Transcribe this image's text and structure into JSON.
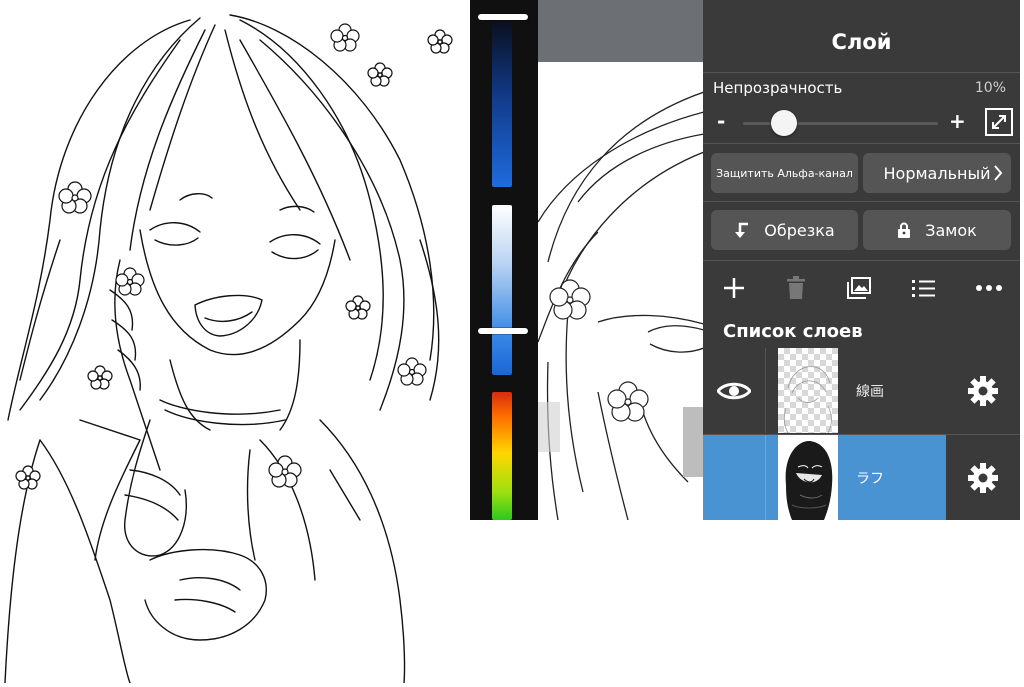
{
  "panel": {
    "title": "Слой",
    "opacity_label": "Непрозрачность",
    "opacity_value": "10%",
    "opacity_fraction": 0.1,
    "minus": "-",
    "plus": "+",
    "protect_alpha_label": "Защитить Альфа-канал",
    "blend_mode": "Нормальный",
    "clipping_label": "Обрезка",
    "lock_label": "Замок",
    "list_title": "Список слоев"
  },
  "toolbar_icons": [
    "add-icon",
    "trash-icon",
    "image-icon",
    "list-icon",
    "more-icon"
  ],
  "layers": [
    {
      "name": "線画",
      "selected": false,
      "visible": true
    },
    {
      "name": "ラフ",
      "selected": true,
      "visible": false
    }
  ],
  "colors": {
    "panel_bg": "#3a3a3a",
    "button_bg": "#555555",
    "selected_layer": "#4a93d2",
    "canvas_topbar": "#6c6f73"
  }
}
